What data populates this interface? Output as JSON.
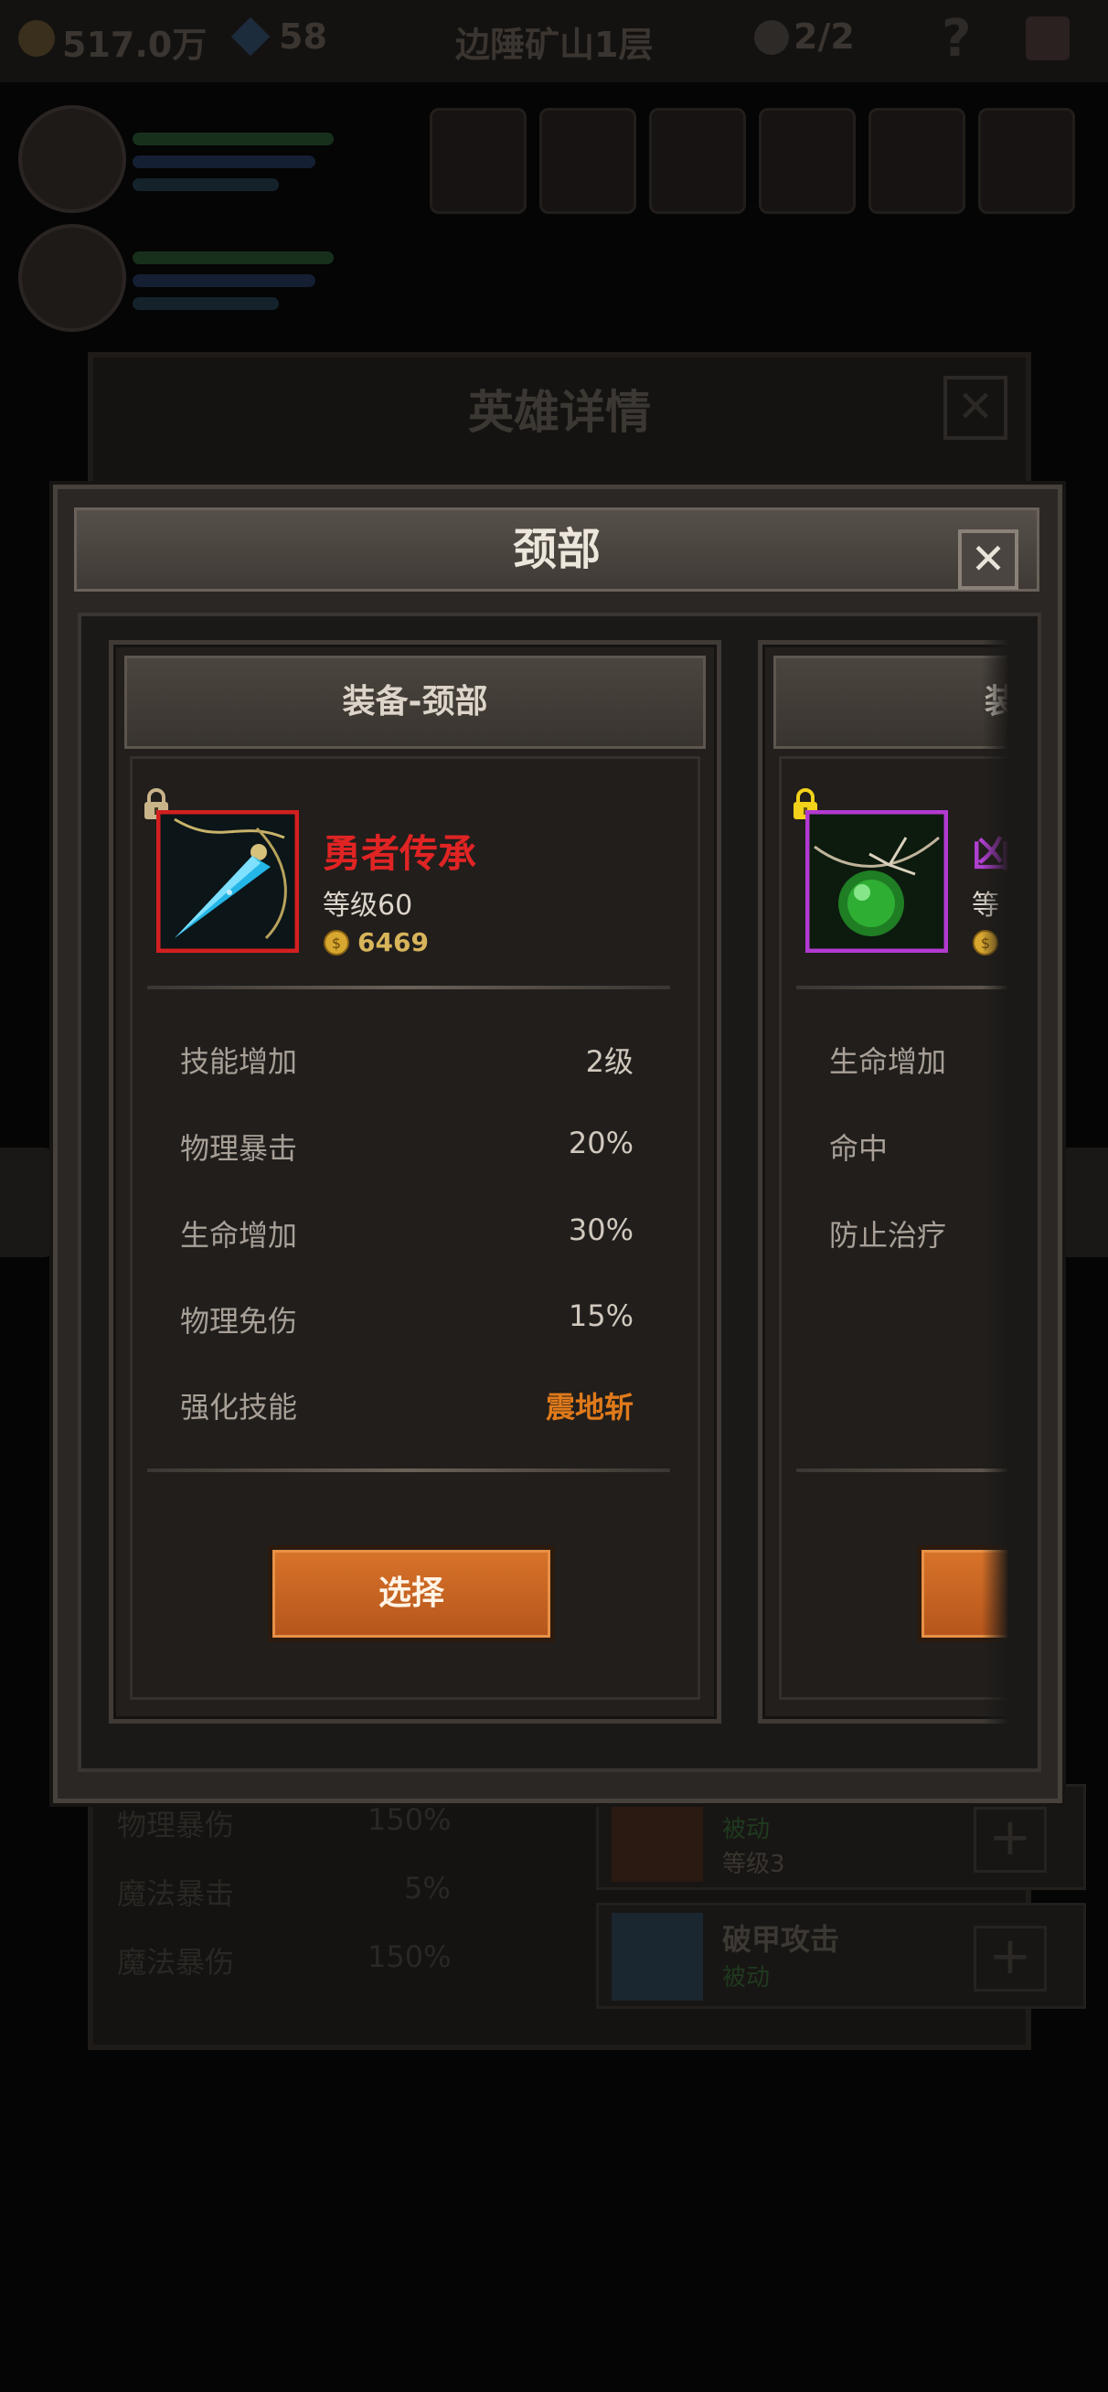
{
  "background": {
    "gold": "517.0万",
    "gems": "58",
    "location": "边陲矿山1层",
    "kills": "2/2",
    "help": "?",
    "hero_dialog_title": "英雄详情",
    "close_symbol": "✕",
    "stats": [
      {
        "label": "物理暴伤",
        "value": "150%"
      },
      {
        "label": "魔法暴击",
        "value": "5%"
      },
      {
        "label": "魔法暴伤",
        "value": "150%"
      }
    ],
    "skills": [
      {
        "name": "",
        "tag": "被动",
        "level": "等级3"
      },
      {
        "name": "破甲攻击",
        "tag": "被动",
        "level": ""
      }
    ],
    "plus": "+"
  },
  "modal": {
    "title": "颈部",
    "close_symbol": "✕"
  },
  "cards": [
    {
      "header": "装备-颈部",
      "name": "勇者传承",
      "name_color": "#e02424",
      "frame_color": "#d21f1f",
      "level": "等级60",
      "price": "6469",
      "locked": true,
      "lock_color": "#c9b48a",
      "gem_icon": "blue-crystal-pendant-icon",
      "stats": [
        {
          "label": "技能增加",
          "value": "2级"
        },
        {
          "label": "物理暴击",
          "value": "20%"
        },
        {
          "label": "生命增加",
          "value": "30%"
        },
        {
          "label": "物理免伤",
          "value": "15%"
        },
        {
          "label": "强化技能",
          "value": "震地斩",
          "accent": true
        }
      ],
      "button": "选择"
    },
    {
      "header": "装",
      "name": "凶",
      "name_color": "#b040d0",
      "frame_color": "#b23ad0",
      "level": "等",
      "price": "",
      "locked": true,
      "lock_color": "#f2d21a",
      "gem_icon": "green-orb-pendant-icon",
      "stats": [
        {
          "label": "生命增加",
          "value": ""
        },
        {
          "label": "命中",
          "value": ""
        },
        {
          "label": "防止治疗",
          "value": ""
        }
      ],
      "button": ""
    }
  ]
}
